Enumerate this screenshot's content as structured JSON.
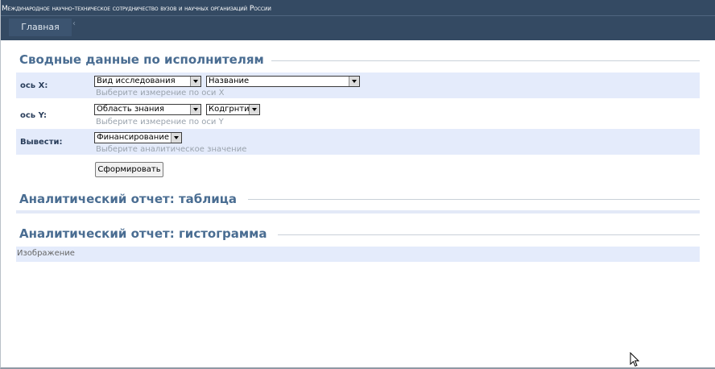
{
  "header": {
    "site_title": "Международное научно-техническое сотрудничество вузов и научных организаций России",
    "nav_home": "Главная"
  },
  "summary": {
    "title": "Сводные данные по исполнителям",
    "axis_x": {
      "label": "ось X:",
      "select_1": "Вид исследования",
      "select_2": "Название",
      "hint": "Выберите измерение по оси X"
    },
    "axis_y": {
      "label": "ось Y:",
      "select_1": "Область знания",
      "select_2": "Кодгрнти",
      "hint": "Выберите измерение по оси Y"
    },
    "output": {
      "label": "Вывести:",
      "select": "Финансирование",
      "hint": "Выберите аналитическое значение"
    },
    "button": "Сформировать"
  },
  "report_table": {
    "title": "Аналитический отчет: таблица"
  },
  "report_chart": {
    "title": "Аналитический отчет: гистограмма",
    "image_placeholder": "Изображение"
  }
}
